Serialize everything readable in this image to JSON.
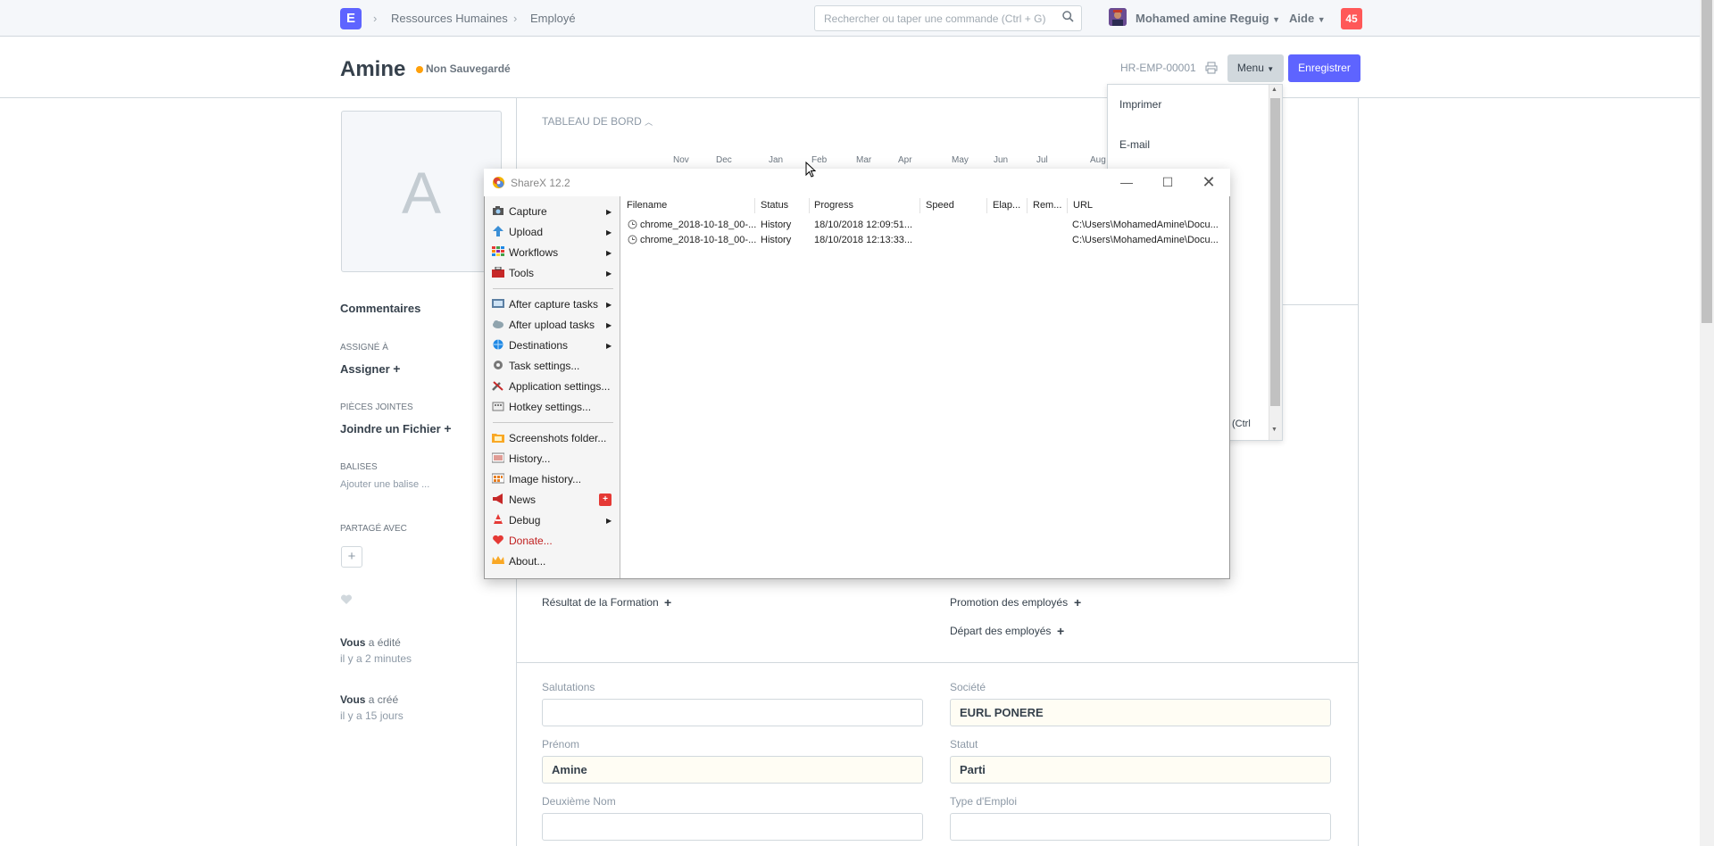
{
  "navbar": {
    "logo_letter": "E",
    "breadcrumbs": [
      "Ressources Humaines",
      "Employé"
    ],
    "search_placeholder": "Rechercher ou taper une commande (Ctrl + G)",
    "user_name": "Mohamed amine Reguig",
    "help_label": "Aide",
    "notification_count": "45"
  },
  "page_header": {
    "title": "Amine",
    "status": "Non Sauvegardé",
    "doc_id": "HR-EMP-00001",
    "menu_label": "Menu",
    "save_label": "Enregistrer"
  },
  "sidebar": {
    "avatar_initial": "A",
    "comments": "Commentaires",
    "assigned_heading": "ASSIGNÉ À",
    "assign_label": "Assigner",
    "attachments_heading": "PIÈCES JOINTES",
    "attach_label": "Joindre un Fichier",
    "tags_heading": "BALISES",
    "tags_placeholder": "Ajouter une balise ...",
    "shared_heading": "PARTAGÉ AVEC",
    "activity": [
      {
        "who": "Vous",
        "action": "a édité",
        "when": "il y a 2 minutes"
      },
      {
        "who": "Vous",
        "action": "a créé",
        "when": "il y a 15 jours"
      }
    ]
  },
  "dashboard": {
    "heading": "TABLEAU DE BORD",
    "months": [
      "Nov",
      "Dec",
      "Jan",
      "Feb",
      "Mar",
      "Apr",
      "May",
      "Jun",
      "Jul",
      "Aug"
    ],
    "links": [
      "Résultat de la Formation",
      "Promotion des employés",
      "Départ des employés"
    ]
  },
  "form": {
    "fields": [
      {
        "label": "Salutations",
        "value": ""
      },
      {
        "label": "Société",
        "value": "EURL PONERE"
      },
      {
        "label": "Prénom",
        "value": "Amine"
      },
      {
        "label": "Statut",
        "value": "Parti"
      },
      {
        "label": "Deuxième Nom",
        "value": ""
      },
      {
        "label": "Type d'Emploi",
        "value": ""
      }
    ]
  },
  "dropdown": {
    "items": [
      "Imprimer",
      "E-mail"
    ],
    "partial_text": "(Ctrl"
  },
  "sharex": {
    "title": "ShareX 12.2",
    "menu": [
      {
        "label": "Capture",
        "icon": "camera-icon",
        "submenu": true
      },
      {
        "label": "Upload",
        "icon": "upload-arrow-icon",
        "submenu": true
      },
      {
        "label": "Workflows",
        "icon": "workflows-grid-icon",
        "submenu": true
      },
      {
        "label": "Tools",
        "icon": "toolbox-icon",
        "submenu": true
      },
      {
        "label": "After capture tasks",
        "icon": "after-capture-icon",
        "submenu": true
      },
      {
        "label": "After upload tasks",
        "icon": "cloud-icon",
        "submenu": true
      },
      {
        "label": "Destinations",
        "icon": "globe-icon",
        "submenu": true
      },
      {
        "label": "Task settings...",
        "icon": "gear-icon",
        "submenu": false
      },
      {
        "label": "Application settings...",
        "icon": "wrench-icon",
        "submenu": false
      },
      {
        "label": "Hotkey settings...",
        "icon": "keyboard-icon",
        "submenu": false
      },
      {
        "label": "Screenshots folder...",
        "icon": "folder-icon",
        "submenu": false
      },
      {
        "label": "History...",
        "icon": "history-icon",
        "submenu": false
      },
      {
        "label": "Image history...",
        "icon": "image-history-icon",
        "submenu": false
      },
      {
        "label": "News",
        "icon": "megaphone-icon",
        "submenu": false
      },
      {
        "label": "Debug",
        "icon": "cone-icon",
        "submenu": true
      },
      {
        "label": "Donate...",
        "icon": "heart-icon",
        "submenu": false
      },
      {
        "label": "About...",
        "icon": "crown-icon",
        "submenu": false
      }
    ],
    "columns": [
      "Filename",
      "Status",
      "Progress",
      "Speed",
      "Elap...",
      "Rem...",
      "URL"
    ],
    "rows": [
      {
        "filename": "chrome_2018-10-18_00-...",
        "status": "History",
        "progress": "18/10/2018 12:09:51...",
        "url": "C:\\Users\\MohamedAmine\\Docu..."
      },
      {
        "filename": "chrome_2018-10-18_00-...",
        "status": "History",
        "progress": "18/10/2018 12:13:33...",
        "url": "C:\\Users\\MohamedAmine\\Docu..."
      }
    ]
  },
  "colors": {
    "brand": "#5e64ff",
    "notification": "#ff5858",
    "unsaved_dot": "#ffa00a"
  }
}
